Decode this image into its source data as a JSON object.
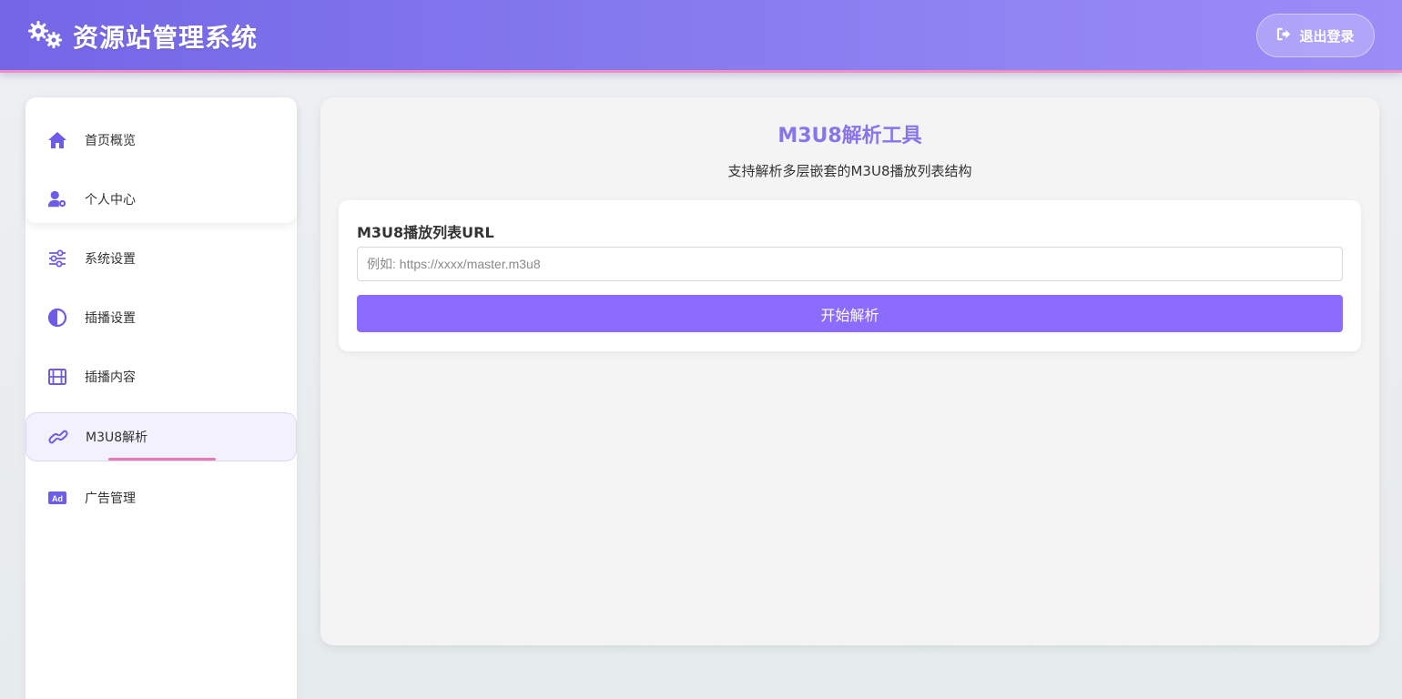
{
  "header": {
    "title": "资源站管理系统",
    "logo_icon": "gears-icon",
    "logout_label": "退出登录",
    "logout_icon": "sign-out-icon"
  },
  "sidebar": {
    "items": [
      {
        "label": "首页概览",
        "icon": "home-icon",
        "active": false
      },
      {
        "label": "个人中心",
        "icon": "user-cog-icon",
        "active": false
      },
      {
        "label": "系统设置",
        "icon": "sliders-icon",
        "active": false
      },
      {
        "label": "插播设置",
        "icon": "half-circle-icon",
        "active": false
      },
      {
        "label": "插播内容",
        "icon": "film-icon",
        "active": false
      },
      {
        "label": "M3U8解析",
        "icon": "link-icon",
        "active": true
      },
      {
        "label": "广告管理",
        "icon": "ad-icon",
        "active": false
      }
    ]
  },
  "main": {
    "title": "M3U8解析工具",
    "subtitle": "支持解析多层嵌套的M3U8播放列表结构",
    "url_label": "M3U8播放列表URL",
    "url_value": "",
    "url_placeholder": "例如: https://xxxx/master.m3u8",
    "parse_button": "开始解析"
  },
  "colors": {
    "accent": "#8b6cff",
    "header_start": "#7466e6",
    "header_end": "#9b8df7",
    "active_underline": "#e879b9",
    "title_color": "#8a74ec",
    "icon_color": "#6c5ce7"
  }
}
